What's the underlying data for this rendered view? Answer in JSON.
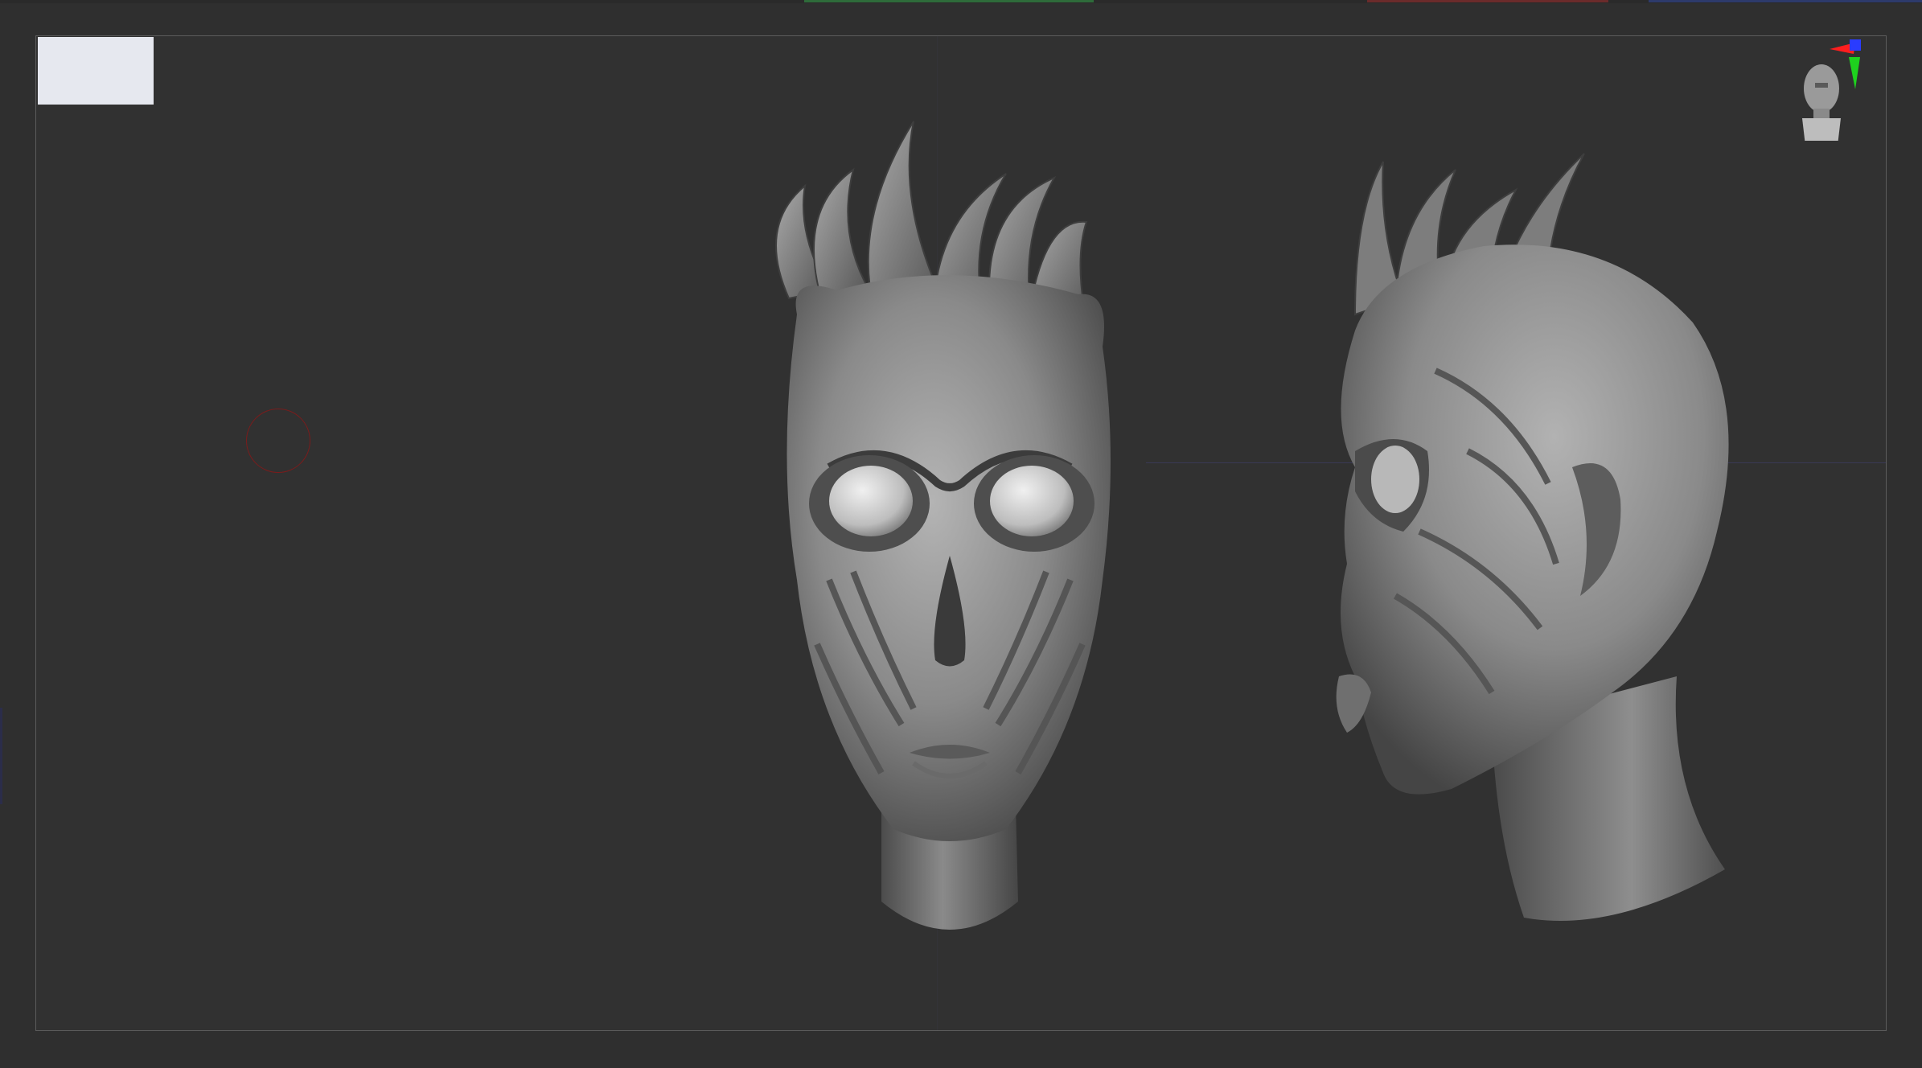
{
  "app": {
    "canvas_background": "#313131",
    "frame_background": "#2f2f2f",
    "viewport_border": "#5c5c5c",
    "swatch_color": "#e6e8ef",
    "brush_cursor_color": "#7a1c1c"
  },
  "top_accent_colors": [
    "#2e6b3a",
    "#6b2b2b",
    "#2d3a6b"
  ],
  "scene": {
    "objects": [
      "front-view-head",
      "side-view-head"
    ],
    "material_color": "#8c8c8c"
  },
  "navigation": {
    "gizmo_axes": [
      "x-axis-red",
      "y-axis-green",
      "z-axis-blue"
    ],
    "axis_colors": {
      "x": "#ff1e1e",
      "y": "#1ed21e",
      "z": "#2a3cff"
    },
    "orientation_icon": "head-bust-icon"
  }
}
